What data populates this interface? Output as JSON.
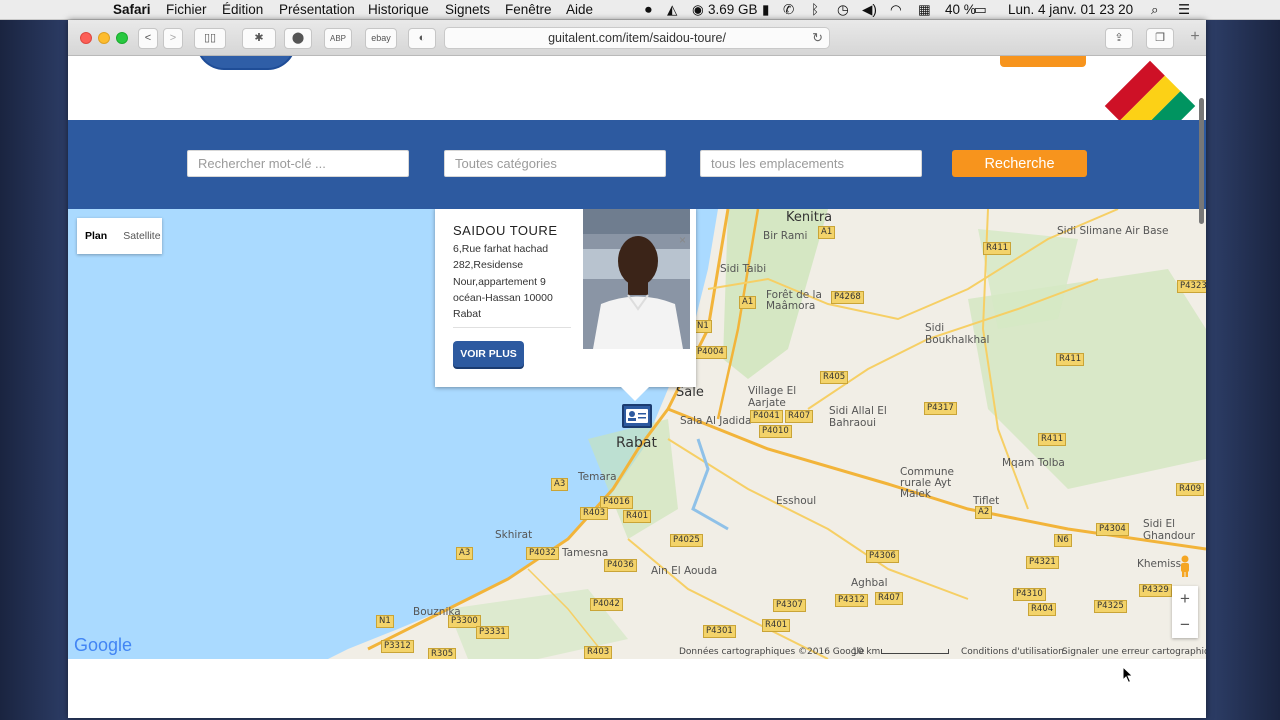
{
  "menubar": {
    "app_name": "Safari",
    "menus": [
      "Fichier",
      "Édition",
      "Présentation",
      "Historique",
      "Signets",
      "Fenêtre",
      "Aide"
    ],
    "status": {
      "memory": "3.69 GB",
      "battery": "40 %",
      "datetime": "Lun. 4 janv.  01 23 20"
    }
  },
  "browser": {
    "url": "guitalent.com/item/saidou-toure/",
    "extensions": [
      "ABP",
      "ebay"
    ]
  },
  "search": {
    "keyword_placeholder": "Rechercher mot-clé ...",
    "category_placeholder": "Toutes catégories",
    "location_placeholder": "tous les emplacements",
    "button_label": "Recherche"
  },
  "brand_colors": {
    "header_blue": "#2d5aa0",
    "accent_orange": "#f7941d",
    "flag": [
      "#ce1126",
      "#fcd116",
      "#009460"
    ]
  },
  "map": {
    "map_types": [
      "Plan",
      "Satellite"
    ],
    "places": {
      "kenitra": "Kenitra",
      "sidi_slimane": "Sidi Slimane Air Base",
      "sidi_taibi": "Sidi Taibi",
      "bir_rami": "Bir Rami",
      "foret_maamora": "Forêt de la\nMaâmora",
      "sidi_boukhalkhal": "Sidi\nBoukhalkhal",
      "sale": "Sale",
      "sala_al_jadida": "Sala Al Jadida",
      "village_aarjate": "Village El\nAarjate",
      "sidi_allal": "Sidi Allal El\nBahraoui",
      "commune_ayt_malek": "Commune\nrurale Ayt\nMalek",
      "mqam_tolba": "Mqam Tolba",
      "rabat": "Rabat",
      "temara": "Temara",
      "esshoul": "Esshoul",
      "tiflet": "Tiflet",
      "skhirat": "Skhirat",
      "tamesna": "Tamesna",
      "ain_el_aouda": "Ain El Aouda",
      "aghbal": "Aghbal",
      "sidi_el_ghandour": "Sidi El\nGhandour",
      "khemisset": "Khemiss",
      "bouznika": "Bouznika"
    },
    "road_labels": [
      "A1",
      "R411",
      "P4323",
      "P4268",
      "A1",
      "N1",
      "P4004",
      "R405",
      "P4317",
      "R411",
      "P4041",
      "R407",
      "P4010",
      "R411",
      "R409",
      "A3",
      "P4016",
      "R403",
      "R401",
      "A2",
      "P4025",
      "N6",
      "P4304",
      "P4032",
      "P4036",
      "A3",
      "P4306",
      "P4321",
      "P4329",
      "P4042",
      "P4307",
      "P4312",
      "R407",
      "P4310",
      "R404",
      "P4325",
      "N1",
      "P3300",
      "P3331",
      "P4301",
      "R401",
      "P3312",
      "R305",
      "R403"
    ],
    "zoom_in": "+",
    "zoom_out": "−",
    "google_logo": "Google",
    "attribution": "Données cartographiques ©2016 Google",
    "scale": "10 km",
    "terms": "Conditions d'utilisation",
    "report": "Signaler une erreur cartographique"
  },
  "infowindow": {
    "name": "SAIDOU TOURE",
    "address": "6,Rue farhat hachad 282,Residense Nour,appartement 9 océan-Hassan 10000 Rabat",
    "button": "VOIR PLUS",
    "close": "×"
  }
}
